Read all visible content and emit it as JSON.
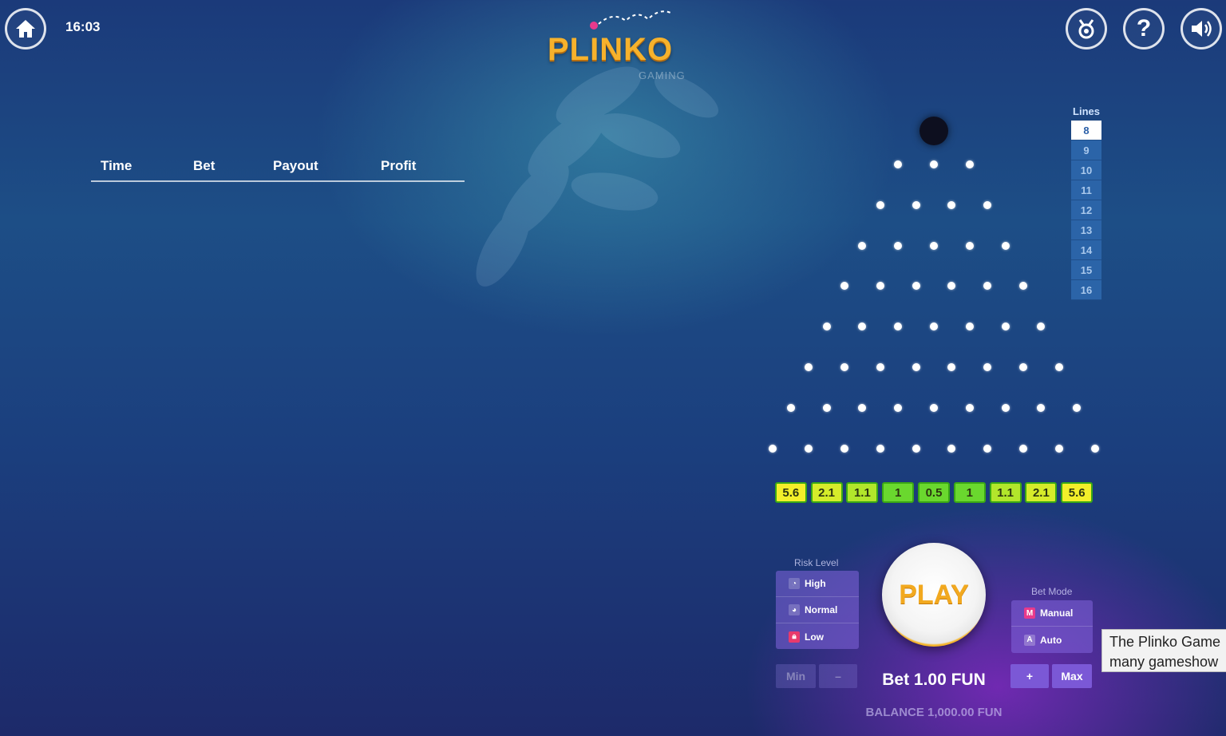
{
  "header": {
    "time": "16:03",
    "logo_text": "PLINKO",
    "logo_sub": "GAMING",
    "icons": [
      "home-icon",
      "trophy-icon",
      "help-icon",
      "sound-icon"
    ]
  },
  "history": {
    "columns": [
      "Time",
      "Bet",
      "Payout",
      "Profit"
    ],
    "rows": []
  },
  "lines": {
    "title": "Lines",
    "options": [
      "8",
      "9",
      "10",
      "11",
      "12",
      "13",
      "14",
      "15",
      "16"
    ],
    "selected": "8"
  },
  "board": {
    "rows": 8,
    "multipliers": [
      "5.6",
      "2.1",
      "1.1",
      "1",
      "0.5",
      "1",
      "1.1",
      "2.1",
      "5.6"
    ],
    "slot_colors": [
      "#f3ef2a",
      "#d6ec2a",
      "#b2e62b",
      "#6ad82e",
      "#6ad82e",
      "#6ad82e",
      "#b2e62b",
      "#d6ec2a",
      "#f3ef2a"
    ]
  },
  "risk": {
    "title": "Risk Level",
    "options": [
      {
        "label": "High",
        "icon": "gauge-high-icon"
      },
      {
        "label": "Normal",
        "icon": "gauge-normal-icon"
      },
      {
        "label": "Low",
        "icon": "lock-icon"
      }
    ]
  },
  "bet_mode": {
    "title": "Bet Mode",
    "options": [
      {
        "label": "Manual",
        "badge": "M"
      },
      {
        "label": "Auto",
        "badge": "A"
      }
    ]
  },
  "controls": {
    "play_label": "PLAY",
    "min_label": "Min",
    "minus_label": "–",
    "plus_label": "+",
    "max_label": "Max",
    "bet_text": "Bet 1.00 FUN",
    "balance_text": "BALANCE 1,000.00 FUN"
  },
  "tooltip": {
    "line1": "The Plinko Game",
    "line2": "many gameshow"
  },
  "colors": {
    "accent_orange": "#f2a91f",
    "panel_purple": "#8264dc",
    "lines_blue": "#2b64a8"
  }
}
